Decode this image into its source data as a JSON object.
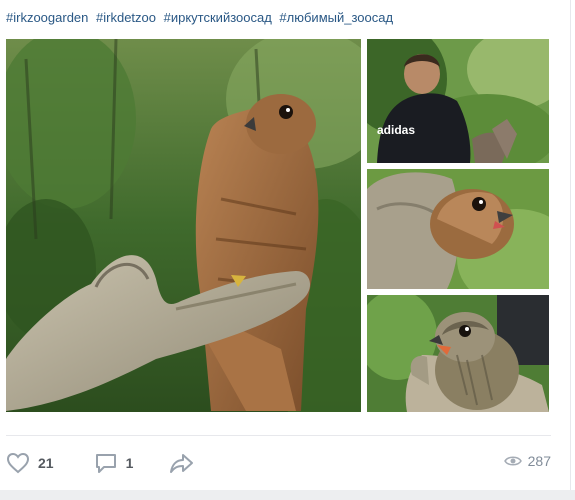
{
  "post": {
    "hashtags": [
      "#irkzoogarden",
      "#irkdetzoo",
      "#иркутскийзоосад",
      "#любимый_зоосад"
    ],
    "photos": [
      {
        "subject": "falcon on gloved hand in forest"
      },
      {
        "subject": "keeper in dark jacket outdoors"
      },
      {
        "subject": "young falcon held in glove"
      },
      {
        "subject": "kestrel chick with open beak"
      }
    ],
    "photo_overlay_text": "adidas",
    "actions": {
      "likes": "21",
      "comments": "1"
    },
    "views": "287"
  },
  "colors": {
    "link": "#2a5885",
    "icon": "#99a2ad",
    "divider": "#e7e8ec"
  }
}
